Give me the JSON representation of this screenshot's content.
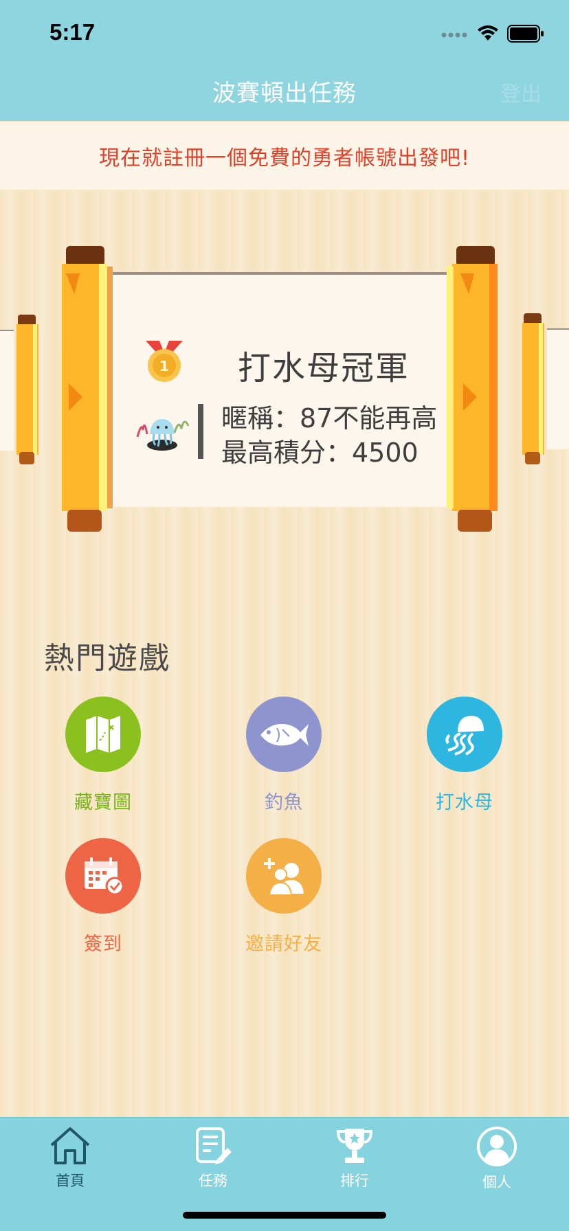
{
  "status": {
    "time": "5:17"
  },
  "nav": {
    "title": "波賽頓出任務",
    "right_label": "登出"
  },
  "banner": {
    "text": "現在就註冊一個免費的勇者帳號出發吧!"
  },
  "champion": {
    "title": "打水母冠軍",
    "nickname_line": "暱稱：87不能再高",
    "score_line": "最高積分：4500"
  },
  "hot_games": {
    "title": "熱門遊戲",
    "items": [
      {
        "label": "藏寶圖",
        "icon": "treasure-map-icon",
        "color": "#8bc11f"
      },
      {
        "label": "釣魚",
        "icon": "fish-icon",
        "color": "#8e95ce"
      },
      {
        "label": "打水母",
        "icon": "jellyfish-icon",
        "color": "#2cb6e0"
      },
      {
        "label": "簽到",
        "icon": "calendar-check-icon",
        "color": "#ee6546"
      },
      {
        "label": "邀請好友",
        "icon": "add-friend-icon",
        "color": "#f4b047"
      }
    ]
  },
  "tabbar": {
    "items": [
      {
        "label": "首頁",
        "icon": "home-icon",
        "active": true
      },
      {
        "label": "任務",
        "icon": "task-icon",
        "active": false
      },
      {
        "label": "排行",
        "icon": "trophy-icon",
        "active": false
      },
      {
        "label": "個人",
        "icon": "profile-icon",
        "active": false
      }
    ]
  }
}
